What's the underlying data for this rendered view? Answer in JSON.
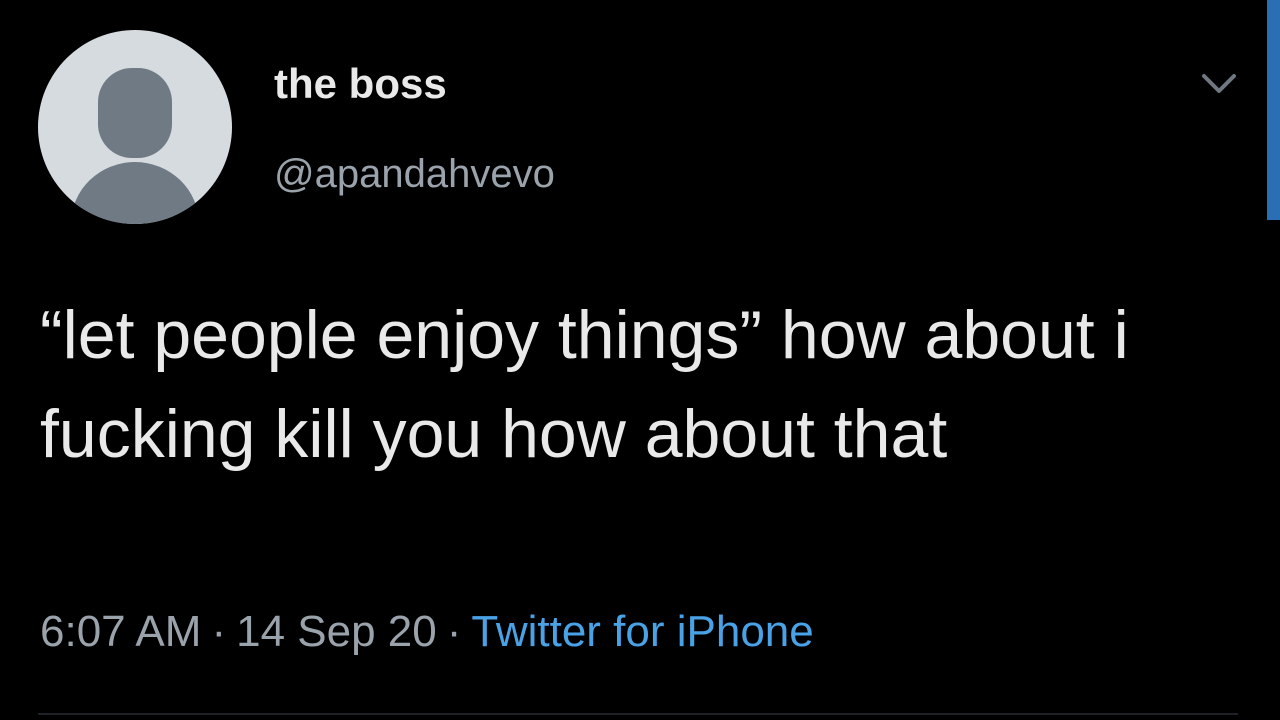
{
  "user": {
    "display_name": "the boss",
    "handle": "@apandahvevo"
  },
  "tweet": {
    "text": "“let people enjoy things” how about i fucking kill you how about that",
    "time": "6:07 AM",
    "separator": "·",
    "date": "14 Sep 20",
    "source": "Twitter for iPhone"
  },
  "icons": {
    "avatar": "default-profile-avatar-icon",
    "menu": "chevron-down-icon"
  },
  "colors": {
    "background": "#000000",
    "text": "#e9e9e9",
    "muted": "#9aa3ab",
    "link": "#4aa2e6",
    "accent": "#2a6fb3"
  }
}
